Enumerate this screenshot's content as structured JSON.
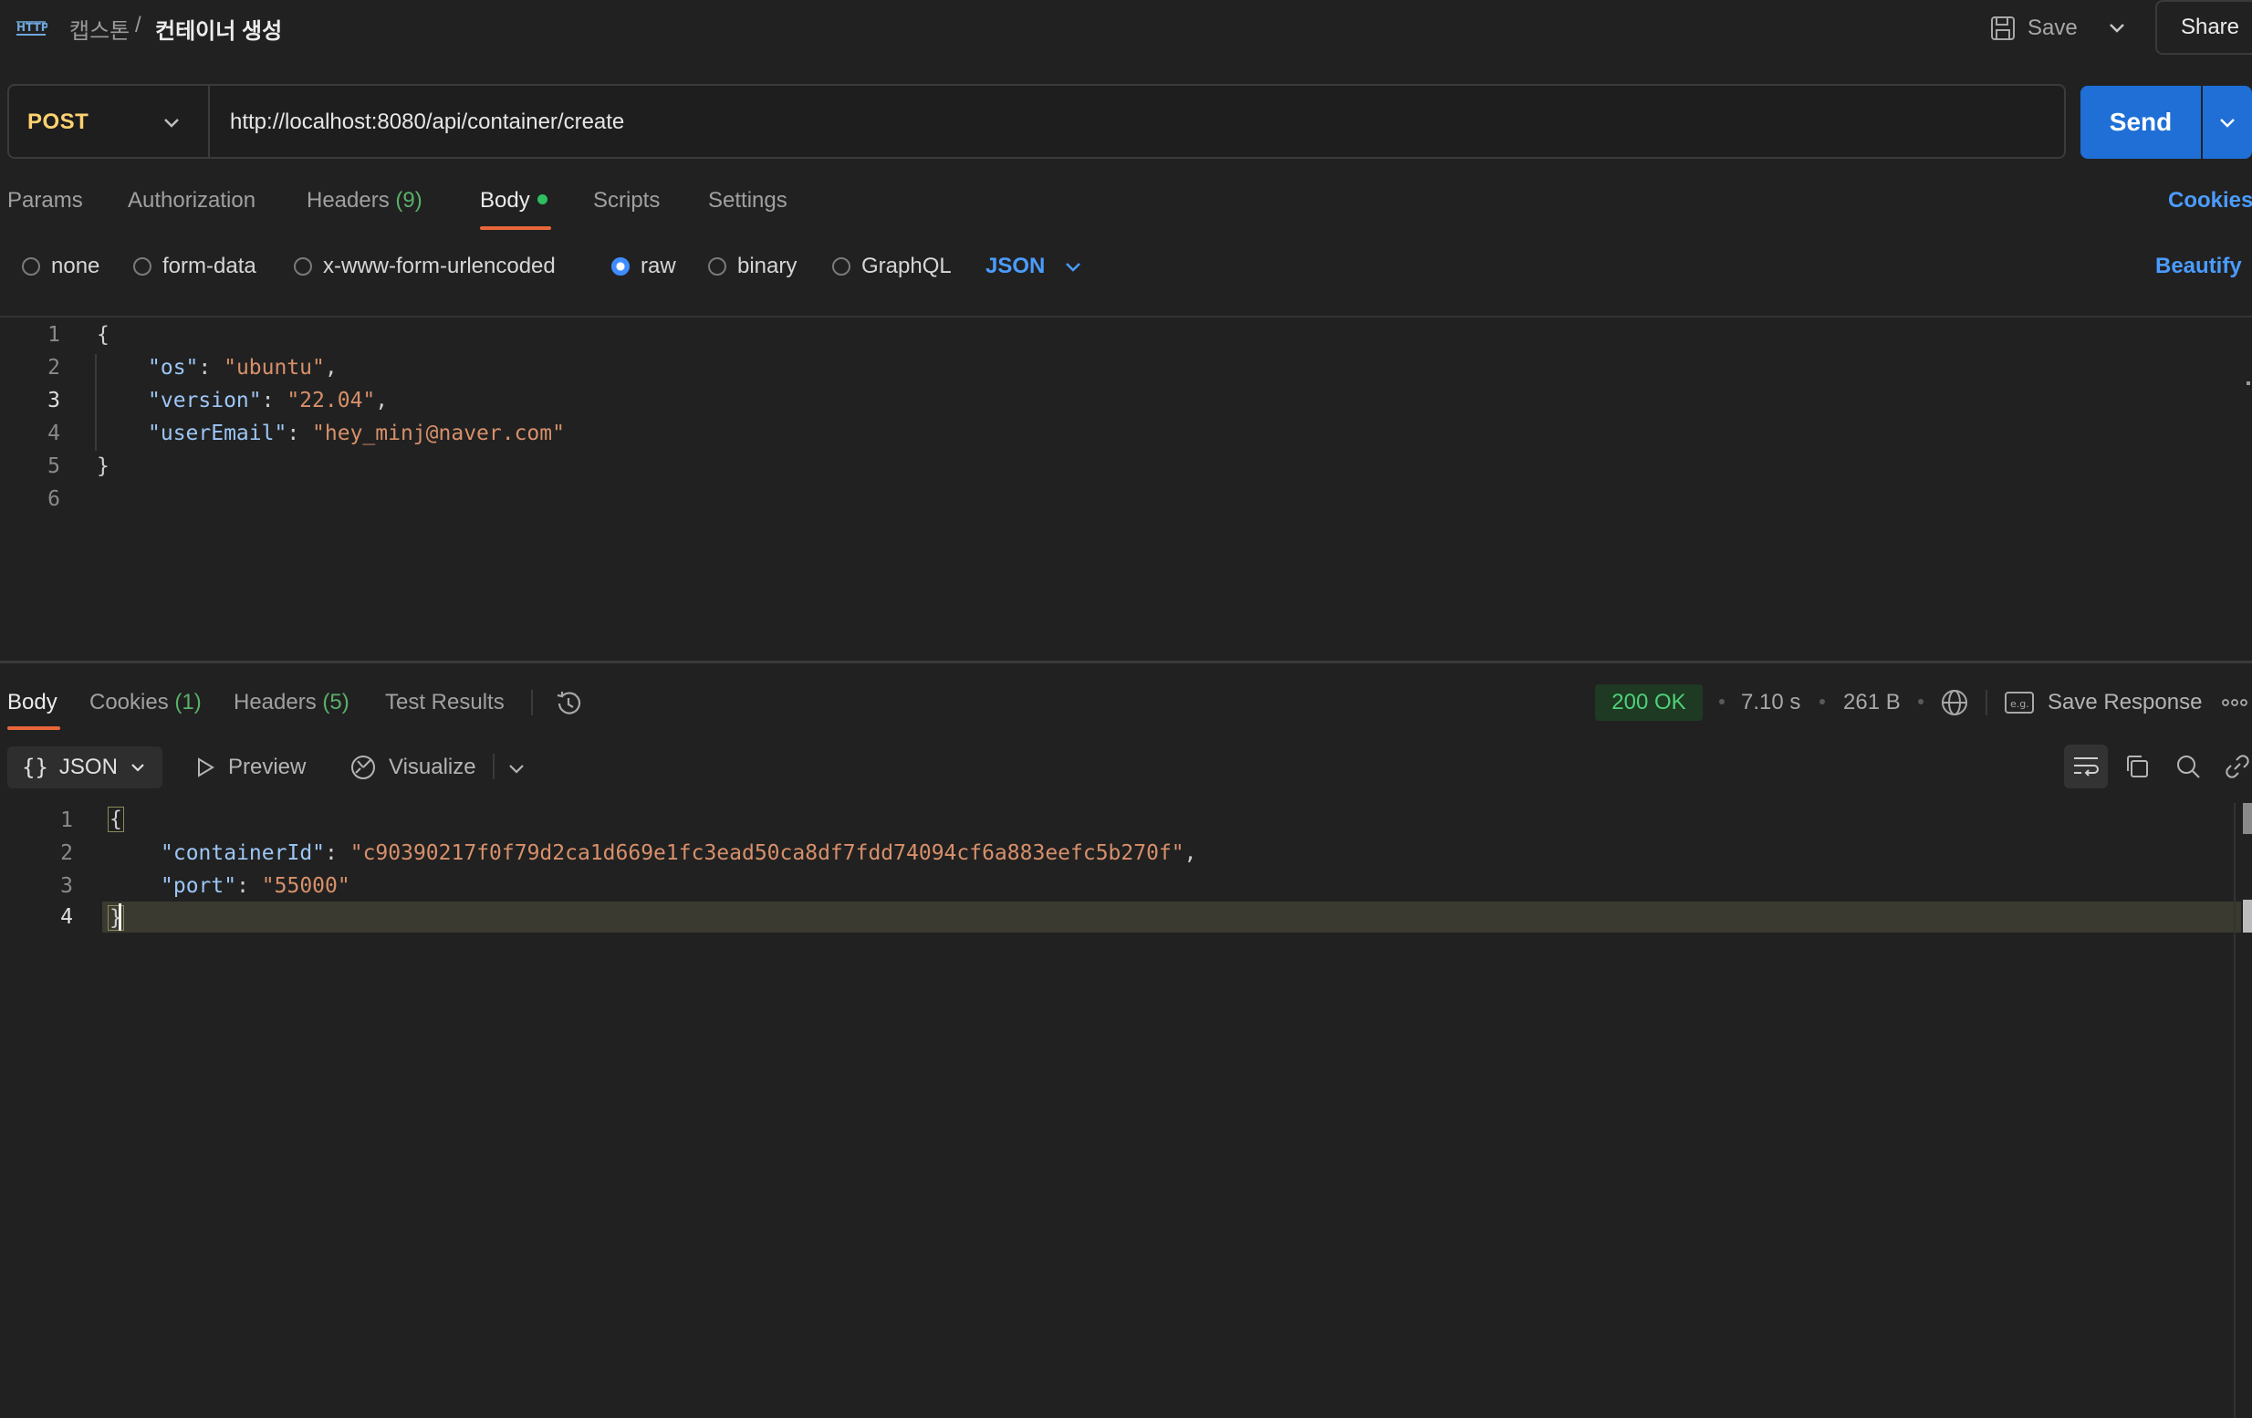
{
  "breadcrumb": {
    "collection": "캡스톤",
    "separator": "/",
    "request": "컨테이너 생성"
  },
  "header": {
    "save_label": "Save",
    "share_label": "Share"
  },
  "request": {
    "method": "POST",
    "url": "http://localhost:8080/api/container/create",
    "send_label": "Send"
  },
  "request_tabs": {
    "params": "Params",
    "authorization": "Authorization",
    "headers": "Headers",
    "headers_count": "(9)",
    "body": "Body",
    "scripts": "Scripts",
    "settings": "Settings",
    "cookies": "Cookies"
  },
  "body_types": {
    "none": "none",
    "form_data": "form-data",
    "urlencoded": "x-www-form-urlencoded",
    "raw": "raw",
    "binary": "binary",
    "graphql": "GraphQL",
    "selected_format": "JSON",
    "beautify": "Beautify"
  },
  "request_body": {
    "line_numbers": [
      "1",
      "2",
      "3",
      "4",
      "5",
      "6"
    ],
    "open": "{",
    "close": "}",
    "os_key": "\"os\"",
    "os_value": "\"ubuntu\"",
    "version_key": "\"version\"",
    "version_value": "\"22.04\"",
    "email_key": "\"userEmail\"",
    "email_value": "\"hey_minj@naver.com\""
  },
  "response_tabs": {
    "body": "Body",
    "cookies": "Cookies",
    "cookies_count": "(1)",
    "headers": "Headers",
    "headers_count": "(5)",
    "test_results": "Test Results"
  },
  "response_meta": {
    "status": "200 OK",
    "time": "7.10 s",
    "size": "261 B",
    "save_response": "Save Response"
  },
  "response_toolbar": {
    "format": "JSON",
    "preview": "Preview",
    "visualize": "Visualize"
  },
  "response_body": {
    "line_numbers": [
      "1",
      "2",
      "3",
      "4"
    ],
    "open": "{",
    "close": "}",
    "container_key": "\"containerId\"",
    "container_value": "\"c90390217f0f79d2ca1d669e1fc3ead50ca8df7fdd74094cf6a883eefc5b270f\"",
    "port_key": "\"port\"",
    "port_value": "\"55000\""
  },
  "colors": {
    "background": "#212121",
    "accent_blue": "#1f6fd6",
    "method_post": "#ffd270",
    "status_ok": "#4ed07a",
    "tab_underline": "#e8673a"
  }
}
